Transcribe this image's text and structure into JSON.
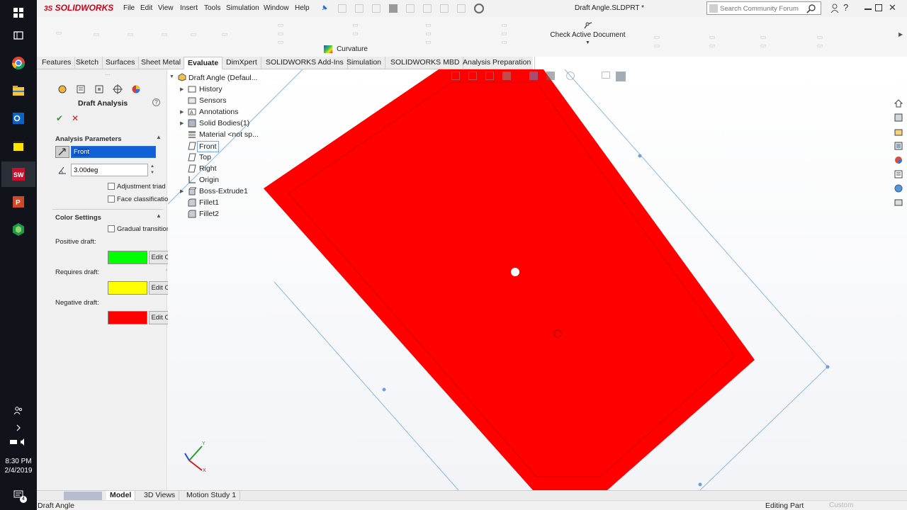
{
  "taskbar": {
    "clock_time": "8:30 PM",
    "clock_date": "2/4/2019",
    "notification_count": "4",
    "icons": [
      "windows-logo-icon",
      "task-view-icon",
      "chrome-icon",
      "file-explorer-icon",
      "outlook-icon",
      "sticky-notes-icon",
      "solidworks-icon",
      "powerpoint-icon",
      "app-hexagon-icon"
    ]
  },
  "titlebar": {
    "logo": "SOLIDWORKS",
    "logo_prefix": "3S",
    "menus": [
      "File",
      "Edit",
      "View",
      "Insert",
      "Tools",
      "Simulation",
      "Window",
      "Help"
    ],
    "document_title": "Draft Angle.SLDPRT *",
    "search_placeholder": "Search Community Forum",
    "accent": "#d0021b"
  },
  "ribbon": {
    "check_active_document": "Check Active Document",
    "curvature": "Curvature"
  },
  "tabs": [
    "Features",
    "Sketch",
    "Surfaces",
    "Sheet Metal",
    "Evaluate",
    "DimXpert",
    "SOLIDWORKS Add-Ins",
    "Simulation",
    "SOLIDWORKS MBD",
    "Analysis Preparation"
  ],
  "active_tab": "Evaluate",
  "property_manager": {
    "title": "Draft Analysis",
    "analysis_parameters_header": "Analysis Parameters",
    "direction_value": "Front",
    "angle_value": "3.00deg",
    "adjustment_triad": "Adjustment triad",
    "face_classification": "Face classification",
    "color_settings_header": "Color Settings",
    "gradual_transition": "Gradual transition",
    "positive_draft_label": "Positive draft:",
    "requires_draft_label": "Requires draft:",
    "negative_draft_label": "Negative draft:",
    "edit_color": "Edit Color...",
    "positive_color": "#00ff00",
    "requires_color": "#ffff00",
    "negative_color": "#ff0000"
  },
  "feature_tree": {
    "root": "Draft Angle  (Defaul...",
    "items": [
      "History",
      "Sensors",
      "Annotations",
      "Solid Bodies(1)",
      "Material <not sp...",
      "Front",
      "Top",
      "Right",
      "Origin",
      "Boss-Extrude1",
      "Fillet1",
      "Fillet2"
    ]
  },
  "bottom_tabs": [
    "Model",
    "3D Views",
    "Motion Study 1"
  ],
  "status": {
    "left": "Draft Angle",
    "right": "Editing Part",
    "units": "Custom"
  }
}
